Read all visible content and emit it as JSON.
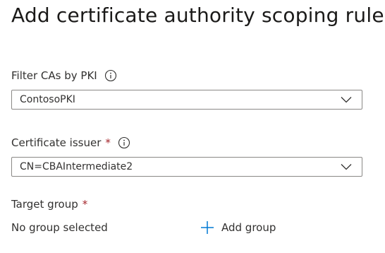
{
  "dialog": {
    "title": "Add certificate authority scoping rule"
  },
  "filter_cas": {
    "label": "Filter CAs by PKI",
    "info_icon": "info-icon",
    "selected_value": "ContosoPKI"
  },
  "certificate_issuer": {
    "label": "Certificate issuer",
    "required_marker": "*",
    "info_icon": "info-icon",
    "selected_value": "CN=CBAIntermediate2"
  },
  "target_group": {
    "label": "Target group",
    "required_marker": "*",
    "empty_text": "No group selected",
    "add_label": "Add group",
    "add_icon": "plus-icon"
  },
  "colors": {
    "text": "#323130",
    "required": "#a4262c",
    "accent": "#0078d4",
    "border": "#8a8886"
  }
}
